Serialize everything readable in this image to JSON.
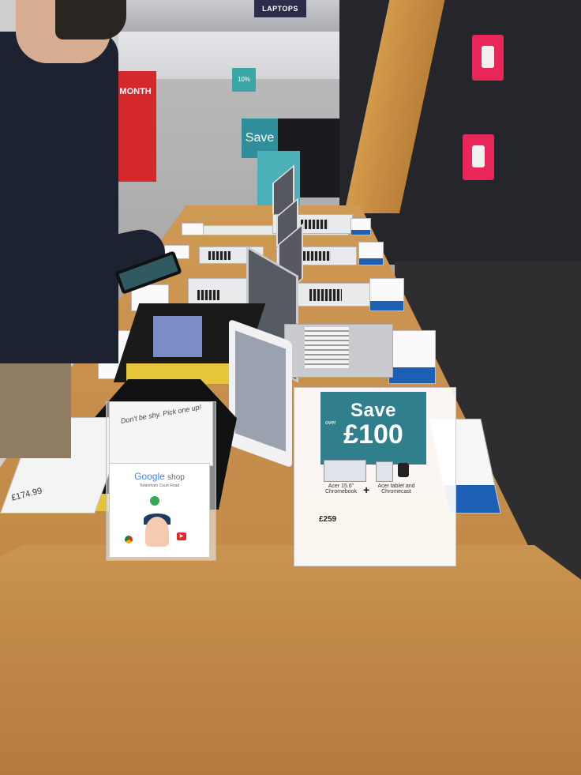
{
  "scene": {
    "signs": {
      "laptops": "LAPTOPS",
      "promo_red_big": "9 MONTH",
      "promo_teal_small": "10%",
      "promo_teal": "Save"
    },
    "save_stand": {
      "save_word": "Save",
      "over_word": "over",
      "amount": "£100",
      "product_a": "Acer 15.6\" Chromebook",
      "plus": "+",
      "product_b": "Acer tablet and Chromecast",
      "price": "£259"
    },
    "leaflet": {
      "back_text": "Don't be shy. Pick one up!",
      "brand": "Google",
      "shop_word": "shop",
      "location": "Tottenham Court Road"
    },
    "left_card_price": "£174.99"
  },
  "colors": {
    "wood": "#c58d4b",
    "teal": "#2f7f8d",
    "accent_blue": "#1e5fb6",
    "sign_pink": "#e8265a",
    "promo_red": "#d4282d"
  }
}
